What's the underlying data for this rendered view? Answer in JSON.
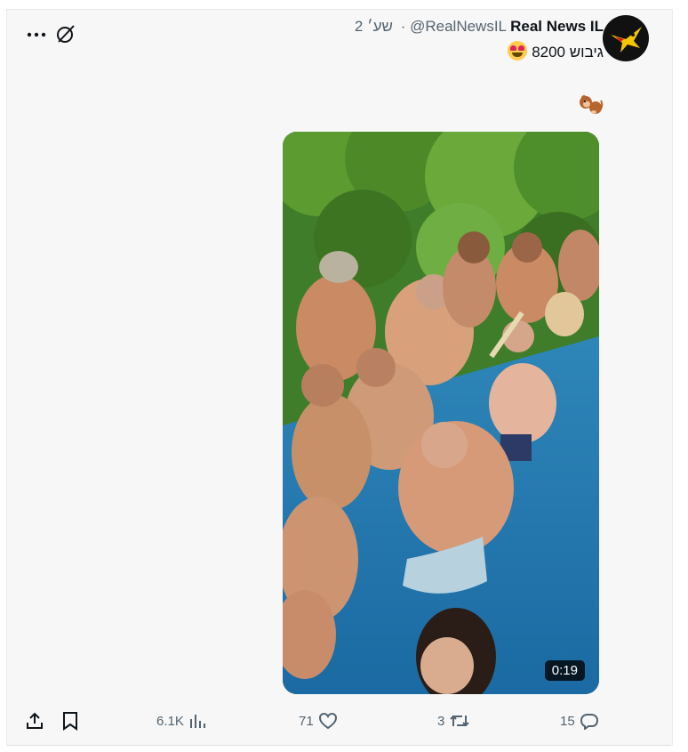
{
  "tweet": {
    "display_name": "Real News IL",
    "handle": "@RealNewsIL",
    "separator": "·",
    "time": "2 שע׳",
    "text": "גיבוש 8200",
    "text_emoji": "smiling-face-with-heart-eyes",
    "second_line_emoji": "monkey"
  },
  "media": {
    "type": "video",
    "duration": "0:19"
  },
  "actions": {
    "replies": "15",
    "retweets": "3",
    "likes": "71",
    "views": "6.1K"
  },
  "icons": {
    "more": "more-horizontal-icon",
    "grok": "grok-icon",
    "share": "share-icon",
    "bookmark": "bookmark-icon",
    "views": "analytics-icon",
    "like": "heart-icon",
    "retweet": "retweet-icon",
    "reply": "reply-icon"
  },
  "colors": {
    "background": "#f7f7f7",
    "text_primary": "#0f1419",
    "text_secondary": "#536471",
    "avatar_bg": "#111111",
    "avatar_bird": "#f2c500"
  }
}
